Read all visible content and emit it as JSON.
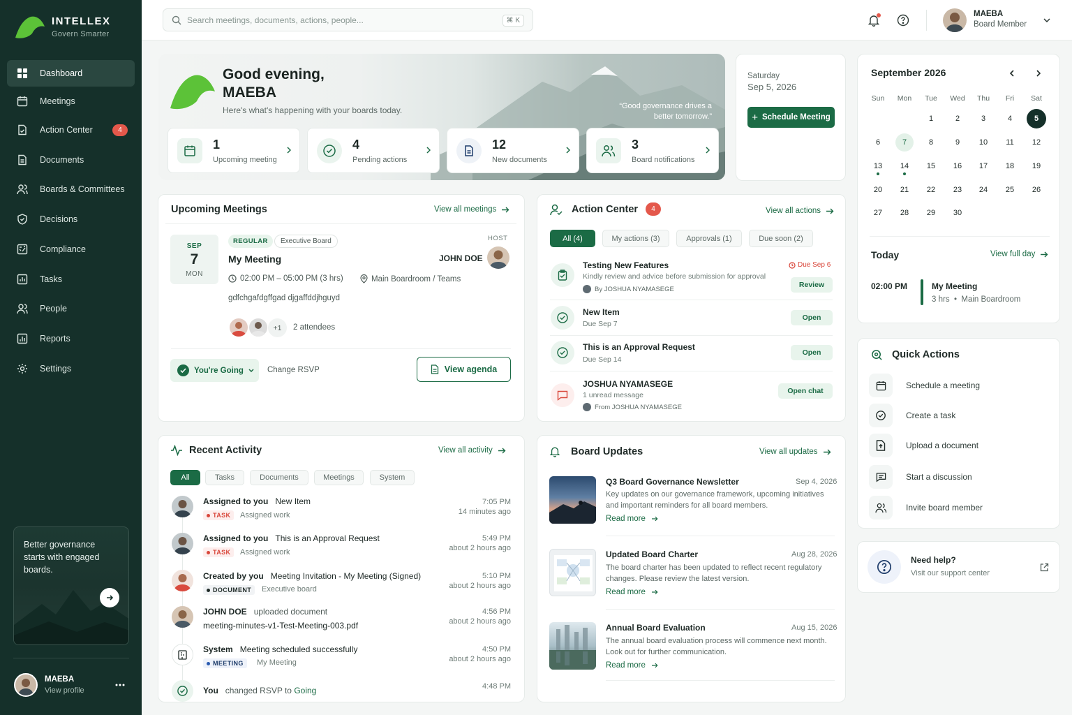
{
  "brand": {
    "name": "INTELLEX",
    "tagline": "Govern Smarter"
  },
  "nav": [
    {
      "label": "Dashboard",
      "icon": "grid-icon"
    },
    {
      "label": "Meetings",
      "icon": "calendar-icon"
    },
    {
      "label": "Action Center",
      "icon": "file-check-icon",
      "badge": "4"
    },
    {
      "label": "Documents",
      "icon": "document-icon"
    },
    {
      "label": "Boards & Committees",
      "icon": "users-icon"
    },
    {
      "label": "Decisions",
      "icon": "shield-icon"
    },
    {
      "label": "Compliance",
      "icon": "compliance-icon"
    },
    {
      "label": "Tasks",
      "icon": "tasks-icon"
    },
    {
      "label": "People",
      "icon": "people-icon"
    },
    {
      "label": "Reports",
      "icon": "reports-icon"
    },
    {
      "label": "Settings",
      "icon": "gear-icon"
    }
  ],
  "promo": {
    "text": "Better governance starts with engaged boards."
  },
  "sidebar_user": {
    "name": "MAEBA",
    "link": "View profile"
  },
  "search": {
    "placeholder": "Search meetings, documents, actions, people...",
    "shortcut": "⌘ K"
  },
  "top_user": {
    "name": "MAEBA",
    "role": "Board Member"
  },
  "hero": {
    "greeting_line1": "Good evening,",
    "greeting_line2": "MAEBA",
    "subtitle": "Here's what's happening with your boards today.",
    "quote": "“Good governance drives a better tomorrow.”",
    "stats": [
      {
        "num": "1",
        "label": "Upcoming meeting"
      },
      {
        "num": "4",
        "label": "Pending actions"
      },
      {
        "num": "12",
        "label": "New documents"
      },
      {
        "num": "3",
        "label": "Board notifications"
      }
    ]
  },
  "date_card": {
    "weekday": "Saturday",
    "date": "Sep 5, 2026",
    "button": "Schedule Meeting"
  },
  "calendar": {
    "month": "September 2026",
    "weekdays": [
      "Sun",
      "Mon",
      "Tue",
      "Wed",
      "Thu",
      "Fri",
      "Sat"
    ],
    "selected": 5,
    "highlight": 7,
    "dots": [
      13,
      14
    ]
  },
  "today": {
    "title": "Today",
    "link": "View full day",
    "time": "02:00 PM",
    "event": "My Meeting",
    "details": "3 hrs  •  Main Boardroom"
  },
  "upcoming": {
    "title": "Upcoming Meetings",
    "link": "View all meetings",
    "month": "SEP",
    "day": "7",
    "weekday": "MON",
    "type": "REGULAR",
    "board": "Executive Board",
    "name": "My Meeting",
    "host_label": "HOST",
    "host": "JOHN DOE",
    "time": "02:00 PM – 05:00 PM (3 hrs)",
    "location": "Main Boardroom / Teams",
    "description": "gdfchgafdgffgad djgaffddjhguyd",
    "attendee_extra": "+1",
    "attendees": "2 attendees",
    "rsvp": "You're Going",
    "change_rsvp": "Change RSVP",
    "agenda": "View agenda"
  },
  "action_center": {
    "title": "Action Center",
    "badge": "4",
    "link": "View all actions",
    "tabs": [
      "All (4)",
      "My actions (3)",
      "Approvals (1)",
      "Due soon (2)"
    ],
    "items": [
      {
        "title": "Testing New Features",
        "sub": "Kindly review and advice before submission for approval",
        "by": "By JOSHUA NYAMASEGE",
        "due": "Due Sep 6",
        "button": "Review"
      },
      {
        "title": "New Item",
        "sub": "Due Sep 7",
        "button": "Open"
      },
      {
        "title": "This is an Approval Request",
        "sub": "Due Sep 14",
        "button": "Open"
      },
      {
        "title": "JOSHUA NYAMASEGE",
        "sub": "1 unread message",
        "by": "From JOSHUA NYAMASEGE",
        "button": "Open chat"
      }
    ]
  },
  "activity": {
    "title": "Recent Activity",
    "link": "View all activity",
    "tabs": [
      "All",
      "Tasks",
      "Documents",
      "Meetings",
      "System"
    ],
    "items": [
      {
        "actor": "Assigned to you",
        "text": "New Item",
        "tag": "TASK",
        "meta": "Assigned work",
        "time": "7:05 PM",
        "ago": "14 minutes ago"
      },
      {
        "actor": "Assigned to you",
        "text": "This is an Approval Request",
        "tag": "TASK",
        "meta": "Assigned work",
        "time": "5:49 PM",
        "ago": "about 2 hours ago"
      },
      {
        "actor": "Created by you",
        "text": "Meeting Invitation - My Meeting (Signed)",
        "tag": "DOCUMENT",
        "meta": "Executive board",
        "time": "5:10 PM",
        "ago": "about 2 hours ago"
      },
      {
        "actor": "JOHN DOE",
        "text": "uploaded document",
        "file": "meeting-minutes-v1-Test-Meeting-003.pdf",
        "time": "4:56 PM",
        "ago": "about 2 hours ago"
      },
      {
        "actor": "System",
        "text": "Meeting scheduled successfully",
        "tag": "MEETING",
        "meta": "My Meeting",
        "time": "4:50 PM",
        "ago": "about 2 hours ago"
      },
      {
        "actor": "You",
        "text": "changed RSVP to",
        "status": "Going",
        "time": "4:48 PM"
      }
    ]
  },
  "board_updates": {
    "title": "Board Updates",
    "link": "View all updates",
    "read_more": "Read more",
    "items": [
      {
        "title": "Q3 Board Governance Newsletter",
        "date": "Sep 4, 2026",
        "body": "Key updates on our governance framework, upcoming initiatives and important reminders for all board members."
      },
      {
        "title": "Updated Board Charter",
        "date": "Aug 28, 2026",
        "body": "The board charter has been updated to reflect recent regulatory changes. Please review the latest version."
      },
      {
        "title": "Annual Board Evaluation",
        "date": "Aug 15, 2026",
        "body": "The annual board evaluation process will commence next month. Look out for further communication."
      }
    ]
  },
  "quick_actions": {
    "title": "Quick Actions",
    "items": [
      "Schedule a meeting",
      "Create a task",
      "Upload a document",
      "Start a discussion",
      "Invite board member"
    ]
  },
  "help": {
    "title": "Need help?",
    "sub": "Visit our support center"
  },
  "colors": {
    "sidebar": "#15302a",
    "accent": "#1b6b45",
    "badge": "#e4584b",
    "brand_green": "#5cc238"
  }
}
